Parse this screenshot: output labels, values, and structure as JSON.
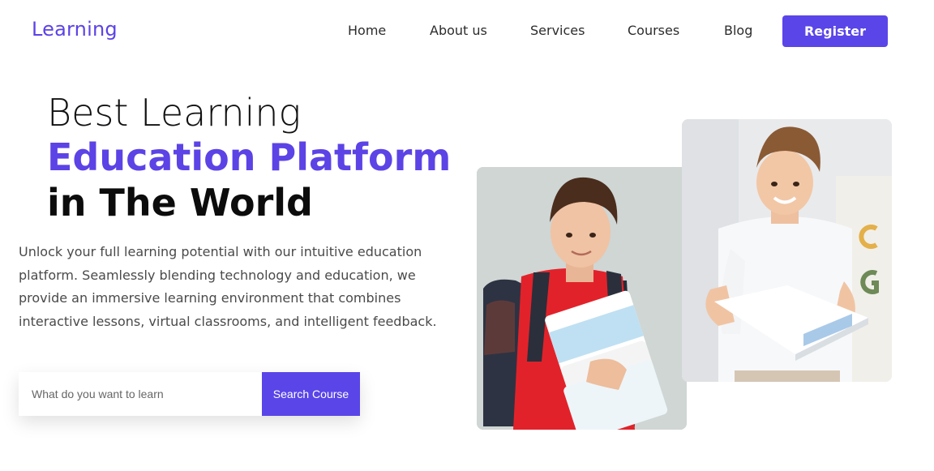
{
  "brand": {
    "logo": "Learning"
  },
  "nav": {
    "items": [
      "Home",
      "About us",
      "Services",
      "Courses",
      "Blog"
    ],
    "register_label": "Register"
  },
  "hero": {
    "line1": "Best Learning",
    "line2": "Education Platform",
    "line3": "in The World",
    "description": "Unlock your full learning potential with our intuitive education platform. Seamlessly blending technology and education, we provide an immersive learning environment that combines interactive lessons, virtual classrooms, and intelligent feedback."
  },
  "search": {
    "placeholder": "What do you want to learn",
    "button_label": "Search Course"
  },
  "colors": {
    "accent": "#5a45e9",
    "text": "#1b1b1b",
    "muted": "#4a4a4a"
  }
}
